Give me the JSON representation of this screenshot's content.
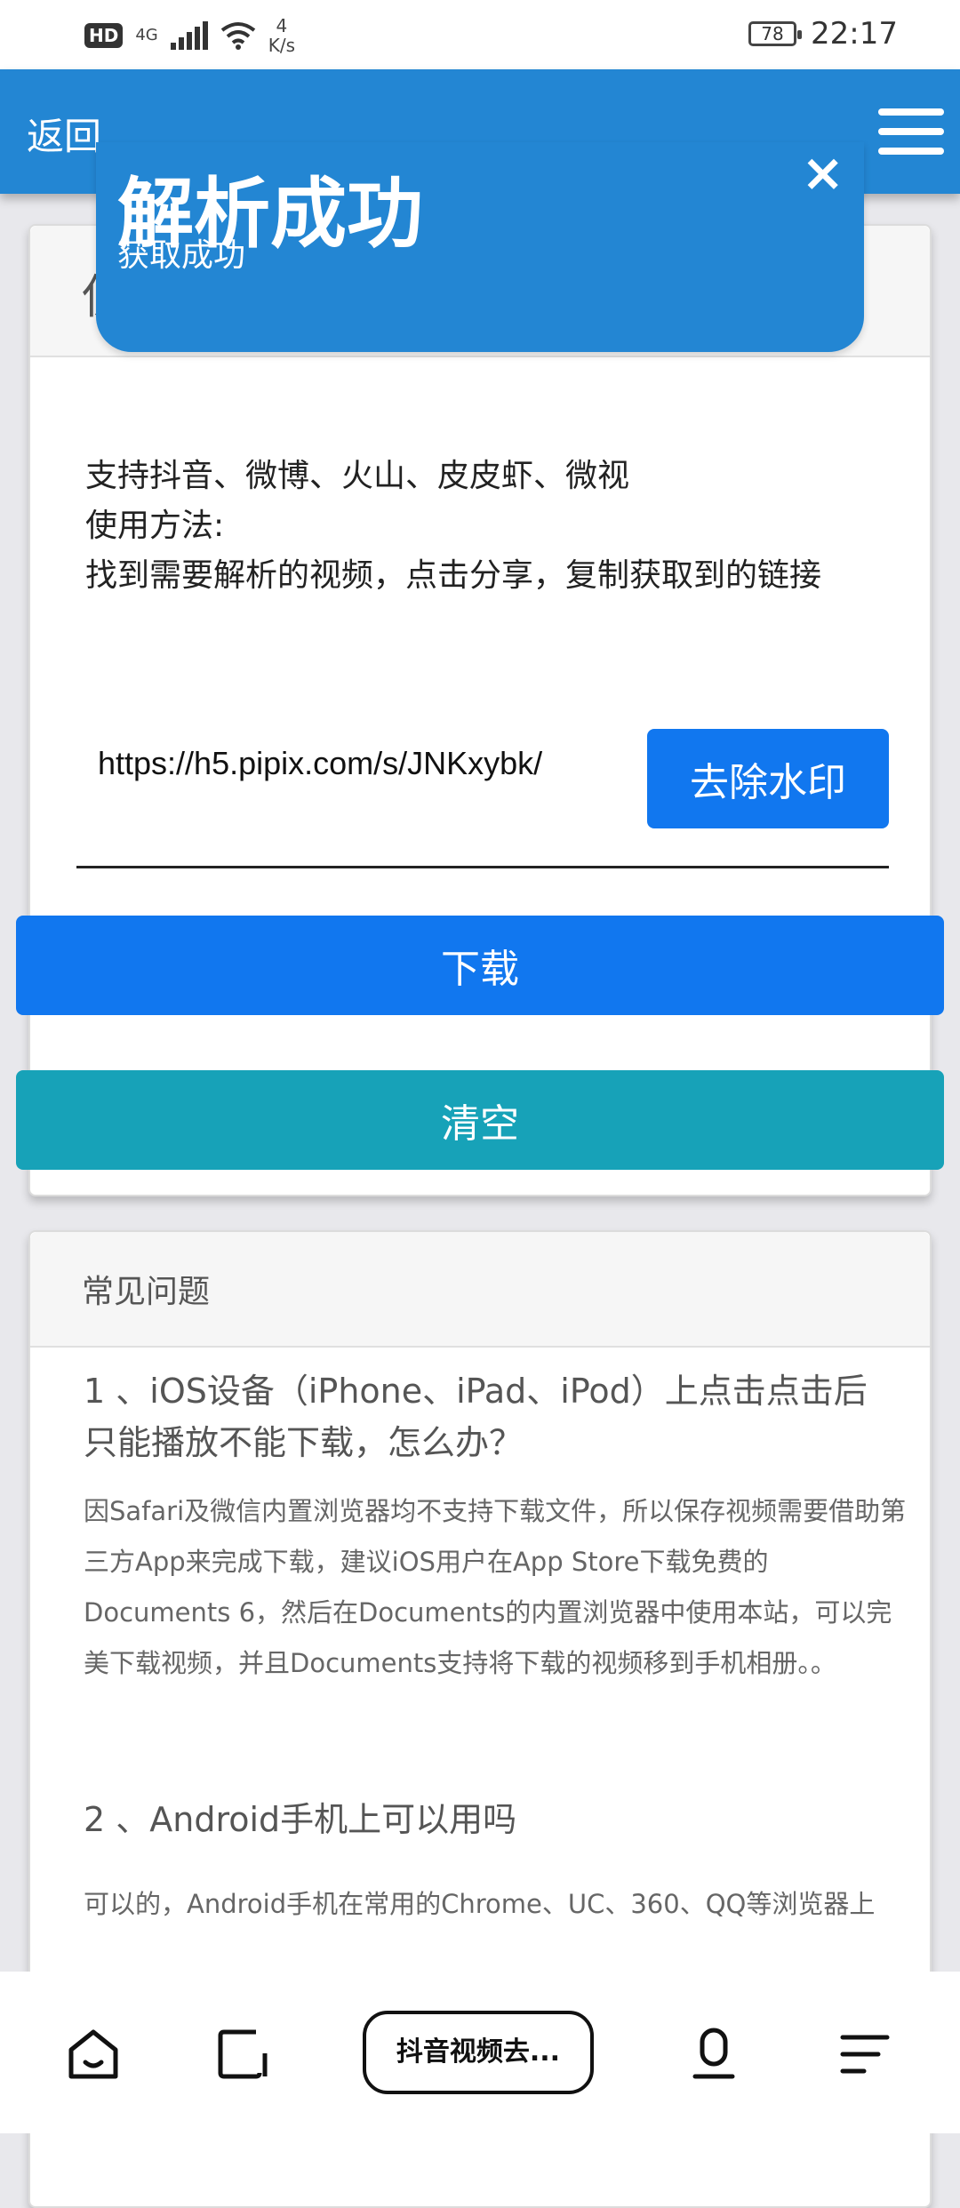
{
  "status_bar": {
    "hd": "HD",
    "network": "4G",
    "speed_value": "4",
    "speed_unit": "K/s",
    "battery": "78",
    "time": "22:17"
  },
  "header": {
    "back_label": "返回"
  },
  "toast": {
    "title": "解析成功",
    "message": "获取成功",
    "close": "×"
  },
  "main_card": {
    "title_partial": "使",
    "intro_lines": [
      "支持抖音、微博、火山、皮皮虾、微视",
      "使用方法:",
      "找到需要解析的视频，点击分享，复制获取到的链接"
    ],
    "url_value": "https://h5.pipix.com/s/JNKxybk/",
    "remove_button": "去除水印",
    "download_button": "下载",
    "clear_button": "清空"
  },
  "faq": {
    "title": "常见问题",
    "items": [
      {
        "question": "1 、iOS设备（iPhone、iPad、iPod）上点击点击后只能播放不能下载，怎么办？",
        "answer": "因Safari及微信内置浏览器均不支持下载文件，所以保存视频需要借助第三方App来完成下载，建议iOS用户在App Store下载免费的Documents 6，然后在Documents的内置浏览器中使用本站，可以完美下载视频，并且Documents支持将下载的视频移到手机相册。。"
      },
      {
        "question": "2 、Android手机上可以用吗",
        "answer": "可以的，Android手机在常用的Chrome、UC、360、QQ等浏览器上"
      }
    ]
  },
  "bottom_bar": {
    "tab_label": "抖音视频去..."
  },
  "colors": {
    "header_blue": "#2386d3",
    "primary_blue": "#1177ef",
    "teal": "#17a2b8"
  }
}
